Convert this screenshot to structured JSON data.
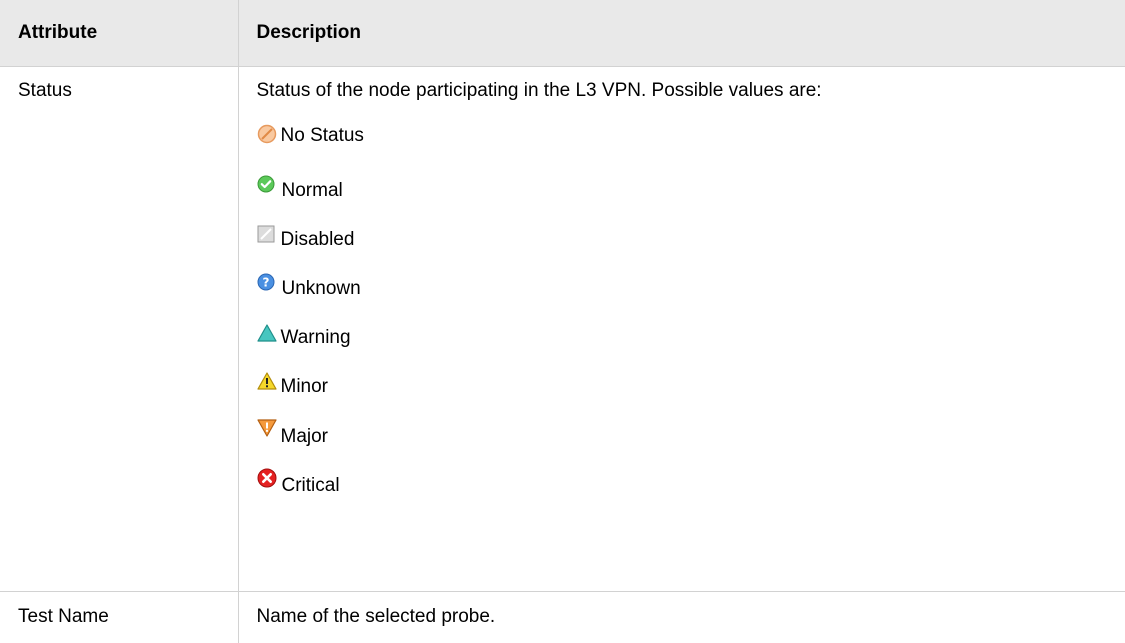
{
  "table": {
    "headers": [
      "Attribute",
      "Description"
    ],
    "rows": [
      {
        "attribute": "Status",
        "description": "Status of the node participating in the L3 VPN. Possible values are:",
        "statuses": [
          {
            "label": "No Status",
            "icon": "no-status-icon",
            "color": "#f2a66b"
          },
          {
            "label": "Normal",
            "icon": "normal-icon",
            "color": "#4cb84a"
          },
          {
            "label": "Disabled",
            "icon": "disabled-icon",
            "color": "#c8c8c8"
          },
          {
            "label": "Unknown",
            "icon": "unknown-icon",
            "color": "#3f86d9"
          },
          {
            "label": "Warning",
            "icon": "warning-icon",
            "color": "#3bbcb8"
          },
          {
            "label": "Minor",
            "icon": "minor-icon",
            "color": "#f2d21a"
          },
          {
            "label": "Major",
            "icon": "major-icon",
            "color": "#f08a24"
          },
          {
            "label": "Critical",
            "icon": "critical-icon",
            "color": "#e21b1b"
          }
        ]
      },
      {
        "attribute": "Test Name",
        "description": "Name of the selected probe."
      }
    ]
  }
}
